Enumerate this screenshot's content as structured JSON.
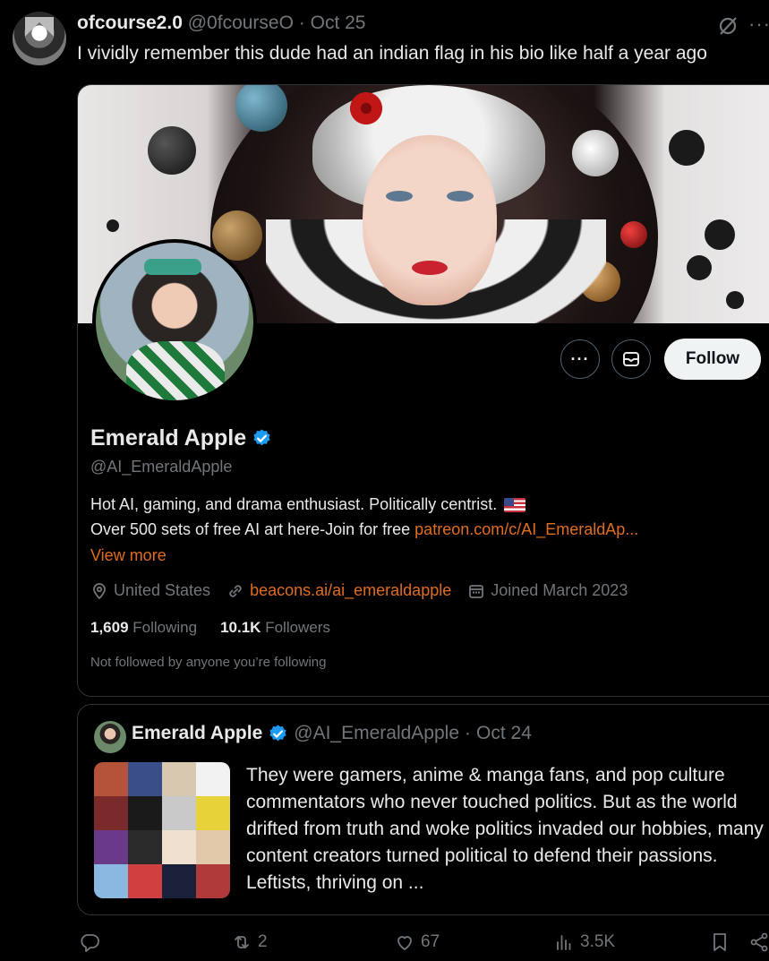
{
  "tweet": {
    "author_name": "ofcourse2.0",
    "author_handle": "@0fcourseO",
    "separator": "·",
    "date": "Oct 25",
    "text": "I vividly remember this dude had an indian flag in his bio like half a year ago",
    "more_label": "···"
  },
  "profile_card": {
    "more_label": "···",
    "follow_label": "Follow",
    "name": "Emerald Apple",
    "handle": "@AI_EmeraldApple",
    "bio_line1": "Hot AI, gaming, and drama enthusiast. Politically centrist.",
    "bio_line2_text": "Over 500 sets of free AI art here-Join for free ",
    "bio_line2_link": "patreon.com/c/AI_EmeraldAp...",
    "view_more": "View more",
    "location": "United States",
    "website": "beacons.ai/ai_emeraldapple",
    "joined": "Joined March 2023",
    "following_count": "1,609",
    "following_label": "Following",
    "followers_count": "10.1K",
    "followers_label": "Followers",
    "not_followed": "Not followed by anyone you’re following"
  },
  "quoted_tweet": {
    "name": "Emerald Apple",
    "handle": "@AI_EmeraldApple",
    "separator": "·",
    "date": "Oct 24",
    "text": "They were gamers, anime & manga fans, and pop culture commentators who never touched politics. But as the world drifted from truth and woke politics invaded our hobbies, many content creators turned political to defend their passions. Leftists, thriving on ..."
  },
  "actions": {
    "reply_icon": "reply-icon",
    "retweets": "2",
    "likes": "67",
    "views": "3.5K"
  },
  "colors": {
    "background": "#000000",
    "text": "#e7e9ea",
    "muted": "#71767b",
    "link": "#e06c1e",
    "verified": "#1d9bf0",
    "border": "#2f3336"
  }
}
